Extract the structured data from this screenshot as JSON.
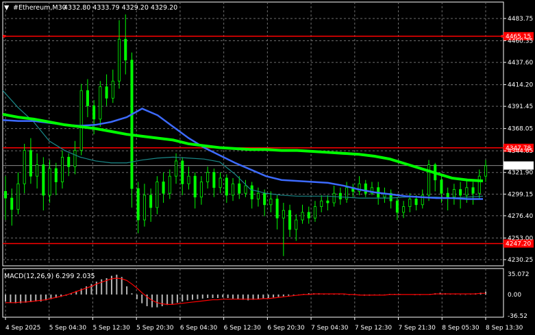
{
  "header": {
    "symbol": "#Ethereum,M30",
    "ohlc": "4332.80 4333.79 4329.20 4329.20",
    "collapse_glyph": "▼"
  },
  "indicator": {
    "label": "MACD(12,26,9) 6.299 2.035"
  },
  "colors": {
    "background": "#000000",
    "grid": "#6e6e6e",
    "candle": "#00ff00",
    "ma_long": "#00ff00",
    "ma_mid": "#3d6bff",
    "ma_short": "#1a8a8a",
    "level_line": "#ff0000",
    "bid_line": "#8a8a8a",
    "macd_hist": "#b8b8b8",
    "macd_signal": "#ff0000"
  },
  "chart_data": {
    "type": "candlestick",
    "ylim": [
      4230.25,
      4483.75
    ],
    "price_ticks": [
      "4483.75",
      "4460.35",
      "4437.60",
      "4414.20",
      "4391.45",
      "4368.05",
      "4344.65",
      "4321.90",
      "4299.15",
      "4276.40",
      "4253.00",
      "4230.25"
    ],
    "time_labels": [
      "4 Sep 2025",
      "5 Sep 04:30",
      "5 Sep 12:30",
      "5 Sep 20:30",
      "6 Sep 04:30",
      "6 Sep 12:30",
      "6 Sep 20:30",
      "7 Sep 04:30",
      "7 Sep 12:30",
      "7 Sep 21:30",
      "8 Sep 05:30",
      "8 Sep 13:30"
    ],
    "levels": [
      {
        "label": "4465.15",
        "price": 4465.15
      },
      {
        "label": "4347.78",
        "price": 4347.78
      },
      {
        "label": "4247.20",
        "price": 4247.2
      }
    ],
    "bid": {
      "label": "4329.20",
      "price": 4329.2
    },
    "ma_long": [
      4383,
      4380,
      4378,
      4375,
      4372,
      4370,
      4368,
      4365,
      4362,
      4360,
      4358,
      4356,
      4352,
      4350,
      4348,
      4347,
      4346,
      4346,
      4345,
      4345,
      4344,
      4343,
      4342,
      4341,
      4339,
      4336,
      4331,
      4326,
      4321,
      4316,
      4314,
      4313
    ],
    "ma_mid": [
      4377,
      4376,
      4376,
      4374,
      4372,
      4371,
      4372,
      4375,
      4380,
      4389,
      4382,
      4370,
      4358,
      4348,
      4340,
      4332,
      4325,
      4318,
      4314,
      4313,
      4312,
      4311,
      4308,
      4304,
      4301,
      4299,
      4297,
      4296,
      4295,
      4295,
      4294,
      4294
    ],
    "ma_short": [
      4408,
      4390,
      4375,
      4355,
      4345,
      4338,
      4334,
      4332,
      4332,
      4335,
      4337,
      4338,
      4337,
      4336,
      4333,
      4320,
      4304,
      4300,
      4298,
      4297,
      4297,
      4297,
      4296,
      4295,
      4295,
      4295,
      4296,
      4296,
      4296,
      4295,
      4296,
      4297
    ],
    "candles": [
      [
        4302,
        4295,
        4318,
        4272
      ],
      [
        4295,
        4283,
        4305,
        4266
      ],
      [
        4283,
        4310,
        4322,
        4278
      ],
      [
        4310,
        4345,
        4352,
        4300
      ],
      [
        4345,
        4318,
        4358,
        4310
      ],
      [
        4318,
        4330,
        4342,
        4305
      ],
      [
        4330,
        4298,
        4338,
        4282
      ],
      [
        4298,
        4326,
        4335,
        4290
      ],
      [
        4326,
        4312,
        4332,
        4298
      ],
      [
        4312,
        4338,
        4345,
        4305
      ],
      [
        4338,
        4328,
        4342,
        4318
      ],
      [
        4328,
        4345,
        4355,
        4320
      ],
      [
        4345,
        4408,
        4415,
        4340
      ],
      [
        4408,
        4392,
        4420,
        4380
      ],
      [
        4392,
        4378,
        4398,
        4362
      ],
      [
        4378,
        4412,
        4418,
        4370
      ],
      [
        4412,
        4400,
        4425,
        4392
      ],
      [
        4400,
        4418,
        4430,
        4395
      ],
      [
        4418,
        4462,
        4482,
        4410
      ],
      [
        4462,
        4440,
        4488,
        4425
      ],
      [
        4440,
        4305,
        4448,
        4285
      ],
      [
        4305,
        4272,
        4312,
        4258
      ],
      [
        4272,
        4298,
        4310,
        4265
      ],
      [
        4298,
        4285,
        4305,
        4270
      ],
      [
        4285,
        4312,
        4318,
        4278
      ],
      [
        4312,
        4300,
        4322,
        4290
      ],
      [
        4300,
        4318,
        4325,
        4294
      ],
      [
        4318,
        4334,
        4342,
        4310
      ],
      [
        4334,
        4310,
        4338,
        4298
      ],
      [
        4310,
        4318,
        4328,
        4304
      ],
      [
        4318,
        4296,
        4322,
        4284
      ],
      [
        4296,
        4312,
        4318,
        4288
      ],
      [
        4312,
        4322,
        4328,
        4305
      ],
      [
        4322,
        4306,
        4326,
        4296
      ],
      [
        4306,
        4316,
        4322,
        4300
      ],
      [
        4316,
        4298,
        4320,
        4290
      ],
      [
        4298,
        4310,
        4316,
        4292
      ],
      [
        4310,
        4300,
        4318,
        4294
      ],
      [
        4300,
        4308,
        4314,
        4296
      ],
      [
        4308,
        4294,
        4312,
        4284
      ],
      [
        4294,
        4300,
        4306,
        4286
      ],
      [
        4300,
        4288,
        4304,
        4276
      ],
      [
        4288,
        4294,
        4302,
        4280
      ],
      [
        4294,
        4274,
        4298,
        4262
      ],
      [
        4274,
        4282,
        4290,
        4234
      ],
      [
        4282,
        4262,
        4288,
        4254
      ],
      [
        4262,
        4272,
        4278,
        4250
      ],
      [
        4272,
        4280,
        4288,
        4268
      ],
      [
        4280,
        4274,
        4286,
        4268
      ],
      [
        4274,
        4286,
        4292,
        4270
      ],
      [
        4286,
        4292,
        4298,
        4280
      ],
      [
        4292,
        4290,
        4298,
        4282
      ],
      [
        4290,
        4300,
        4308,
        4286
      ],
      [
        4300,
        4294,
        4306,
        4288
      ],
      [
        4294,
        4306,
        4312,
        4290
      ],
      [
        4306,
        4302,
        4310,
        4296
      ],
      [
        4302,
        4310,
        4318,
        4298
      ],
      [
        4310,
        4300,
        4314,
        4296
      ],
      [
        4300,
        4306,
        4312,
        4298
      ],
      [
        4306,
        4296,
        4312,
        4288
      ],
      [
        4296,
        4300,
        4306,
        4290
      ],
      [
        4300,
        4292,
        4304,
        4284
      ],
      [
        4292,
        4280,
        4296,
        4272
      ],
      [
        4280,
        4286,
        4292,
        4274
      ],
      [
        4286,
        4294,
        4300,
        4280
      ],
      [
        4294,
        4288,
        4298,
        4282
      ],
      [
        4288,
        4298,
        4304,
        4284
      ],
      [
        4298,
        4330,
        4335,
        4292
      ],
      [
        4330,
        4314,
        4332,
        4302
      ],
      [
        4314,
        4300,
        4318,
        4290
      ],
      [
        4300,
        4296,
        4306,
        4282
      ],
      [
        4296,
        4304,
        4310,
        4288
      ],
      [
        4304,
        4298,
        4312,
        4284
      ],
      [
        4298,
        4306,
        4314,
        4290
      ],
      [
        4306,
        4300,
        4312,
        4288
      ],
      [
        4300,
        4318,
        4325,
        4294
      ],
      [
        4318,
        4329,
        4335,
        4312
      ]
    ]
  },
  "macd": {
    "ylim": [
      -36.52,
      35.07
    ],
    "ticks": [
      "35.072",
      "0.00",
      "-36.52"
    ],
    "histogram": [
      -12,
      -14,
      -15,
      -15,
      -14,
      -13,
      -12,
      -12,
      -10,
      -8,
      -6,
      -4,
      -2,
      2,
      6,
      10,
      14,
      18,
      22,
      26,
      28,
      32,
      34,
      30,
      14,
      2,
      -8,
      -15,
      -20,
      -22,
      -22,
      -20,
      -18,
      -16,
      -14,
      -12,
      -10,
      -9,
      -8,
      -7,
      -6,
      -6,
      -6,
      -5,
      -6,
      -7,
      -8,
      -9,
      -10,
      -9,
      -8,
      -7,
      -6,
      -5,
      -4,
      -3,
      -2,
      -1,
      0,
      1,
      2,
      2,
      2,
      1,
      1,
      1,
      1,
      0,
      -1,
      -1,
      -1,
      -2,
      -2,
      -1,
      0,
      0,
      1,
      1,
      1,
      0,
      0,
      -1,
      -1,
      0,
      1,
      2,
      3,
      2,
      1,
      1,
      0,
      0,
      1,
      2,
      3,
      5
    ],
    "signal": [
      -14,
      -14,
      -14,
      -13,
      -13,
      -12,
      -11,
      -10,
      -9,
      -7,
      -5,
      -3,
      -1,
      2,
      5,
      8,
      11,
      14,
      18,
      21,
      24,
      27,
      28,
      27,
      24,
      18,
      11,
      3,
      -4,
      -10,
      -14,
      -16,
      -17,
      -17,
      -16,
      -15,
      -14,
      -13,
      -12,
      -11,
      -10,
      -9,
      -9,
      -8,
      -8,
      -8,
      -8,
      -8,
      -8,
      -8,
      -8,
      -7,
      -7,
      -6,
      -5,
      -4,
      -3,
      -2,
      -1,
      0,
      0,
      1,
      1,
      1,
      1,
      1,
      1,
      1,
      0,
      0,
      -1,
      -1,
      -1,
      -1,
      -1,
      -1,
      0,
      0,
      0,
      0,
      0,
      0,
      0,
      0,
      0,
      1,
      1,
      1,
      1,
      1,
      1,
      1,
      1,
      1,
      2,
      2
    ]
  }
}
